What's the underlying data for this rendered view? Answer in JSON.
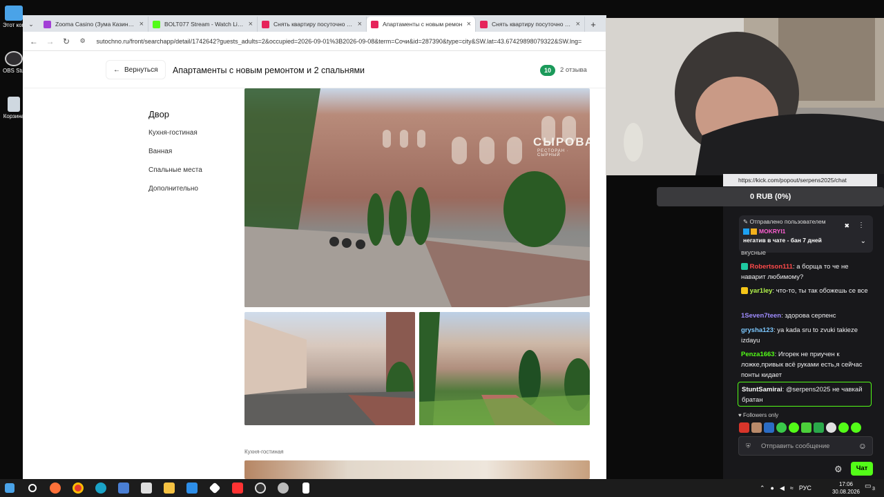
{
  "desktop": {
    "icons": [
      {
        "label": "Этот компьют"
      },
      {
        "label": "OBS Studio"
      },
      {
        "label": "Корзина"
      }
    ]
  },
  "browser": {
    "tabs": [
      {
        "title": "Zooma Casino (Зума Казино) о",
        "color": "#a23fd6"
      },
      {
        "title": "BOLT077 Stream - Watch Live o",
        "color": "#53fc18"
      },
      {
        "title": "Снять квартиру посуточно в С",
        "color": "#e6245b"
      },
      {
        "title": "Апартаменты с новым ремон",
        "color": "#e6245b"
      },
      {
        "title": "Снять квартиру посуточно в Б",
        "color": "#e6245b"
      }
    ],
    "url": "sutochno.ru/front/searchapp/detail/1742642?guests_adults=2&occupied=2026-09-01%3B2026-09-08&term=Сочи&id=287390&type=city&SW.lat=43.67429898079322&SW.lng="
  },
  "page": {
    "back_label": "Вернуться",
    "title": "Апартаменты с новым ремонтом и 2 спальнями",
    "rating": "10",
    "reviews": "2 отзыва",
    "nav": {
      "heading": "Двор",
      "items": [
        "Кухня-гостиная",
        "Ванная",
        "Спальные места",
        "Дополнительно"
      ]
    },
    "section_label": "Кухня-гостиная",
    "photo_sign": "СЫРОВАР",
    "photo_sign_sub": "РЕСТОРАН · СЫРНЫЙ"
  },
  "overlay": {
    "chat_url": "https://kick.com/popout/serpens2025/chat",
    "donation": "0 RUB (0%)",
    "pinned": {
      "header": "Отправлено пользователем",
      "user": "MOKRYI1",
      "text": "негатив в чате - бан 7 дней"
    },
    "partial_line": "вкусные",
    "messages": [
      {
        "user": "Robertson111",
        "color": "#ff4a4a",
        "text": "а борща то че не наварит любимому?"
      },
      {
        "user": "yar1ley",
        "color": "#b3f54b",
        "text": "что-то, ты так обожешь се все"
      },
      {
        "user": "1Seven7teen",
        "color": "#9f8cff",
        "text": "здорова серпенс"
      },
      {
        "user": "grysha123",
        "color": "#7cc8ff",
        "text": "ya kada sru to zvuki takieze izdayu"
      },
      {
        "user": "Penza1663",
        "color": "#53fc18",
        "text": "Игорек не приучен к ложке,привык всё руками есть,я сейчас понты кидает"
      },
      {
        "user": "StuntSamirai",
        "color": "#ffffff",
        "text": "@serpens2025 не чавкай братан"
      }
    ],
    "followers_only": "Followers only",
    "input_placeholder": "Отправить сообщение",
    "chat_button": "Чат"
  },
  "taskbar": {
    "lang": "РУС",
    "time": "17:06",
    "date": "30.08.2026",
    "notif_count": "3"
  }
}
